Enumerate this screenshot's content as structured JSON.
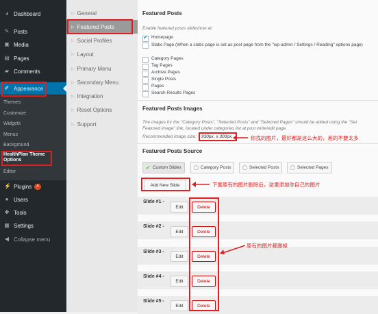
{
  "admin_menu": {
    "items": [
      {
        "label": "Dashboard",
        "icon": "dashboard-icon"
      },
      {
        "label": "Posts",
        "icon": "pin-icon"
      },
      {
        "label": "Media",
        "icon": "media-icon"
      },
      {
        "label": "Pages",
        "icon": "pages-icon"
      },
      {
        "label": "Comments",
        "icon": "comments-icon"
      },
      {
        "label": "Appearance",
        "icon": "brush-icon"
      },
      {
        "label": "Plugins",
        "icon": "plugin-icon",
        "badge": "4"
      },
      {
        "label": "Users",
        "icon": "users-icon"
      },
      {
        "label": "Tools",
        "icon": "wrench-icon"
      },
      {
        "label": "Settings",
        "icon": "settings-icon"
      },
      {
        "label": "Collapse menu",
        "icon": "collapse-icon"
      }
    ],
    "appearance_sub": [
      "Themes",
      "Customize",
      "Widgets",
      "Menus",
      "Background",
      "HealthPlan Theme Options",
      "Editor"
    ]
  },
  "options_nav": [
    "General",
    "Featured Posts",
    "Social Profiles",
    "Layout",
    "Primary Menu",
    "Secondary Menu",
    "Integration",
    "Reset Options",
    "Support"
  ],
  "featured_posts": {
    "title": "Featured Posts",
    "desc": "Enable featured posts slideshow at:",
    "options": [
      {
        "label": "Homepage",
        "checked": true
      },
      {
        "label": "Static Page (When a static page is set as post page from the \"wp-admin / Settings / Reading\" options page)",
        "checked": false
      },
      {
        "label": "Category Pages",
        "checked": false
      },
      {
        "label": "Tag Pages",
        "checked": false
      },
      {
        "label": "Archive Pages",
        "checked": false
      },
      {
        "label": "Single Posts",
        "checked": false
      },
      {
        "label": "Pages",
        "checked": false
      },
      {
        "label": "Search Results Pages",
        "checked": false
      }
    ]
  },
  "images": {
    "title": "Featured Posts Images",
    "desc": "The images for the \"Category Posts\", \"Selected Posts\" and \"Selected Pages\" should be added using the \"Set Featured image\" link, located under categories list at post write/edit page.",
    "recommended_label": "Recommended image size:",
    "recommended_size": "930px. x 300px."
  },
  "source": {
    "title": "Featured Posts Source",
    "tabs": [
      "Custom Slides",
      "Category Posts",
      "Selected Posts",
      "Selected Pages"
    ],
    "add_label": "Add New Slide"
  },
  "slides": [
    {
      "label": "Slide #1 -"
    },
    {
      "label": "Slide #2 -"
    },
    {
      "label": "Slide #3 -"
    },
    {
      "label": "Slide #4 -"
    },
    {
      "label": "Slide #5 -"
    }
  ],
  "buttons": {
    "edit": "Edit",
    "delete": "Delete"
  },
  "annotations": {
    "image_size_note": "你找的图片，最好都是这么大的，差的不要太多",
    "add_note": "下面原有的图片删除后，这里添加你自己的图片",
    "delete_note": "原有的图片都删掉"
  },
  "colors": {
    "highlight": "#e02020",
    "wp_blue": "#0073aa",
    "sidebar": "#23282d"
  }
}
